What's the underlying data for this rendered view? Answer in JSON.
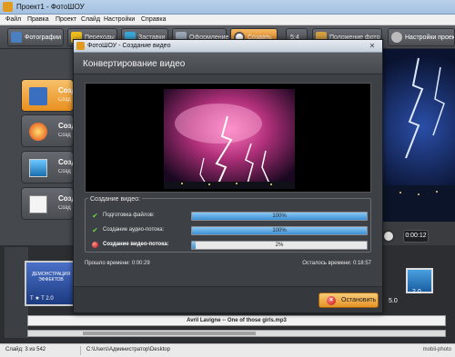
{
  "window": {
    "title": "Проект1 - ФотоШОУ"
  },
  "menu": [
    "Файл",
    "Правка",
    "Проект",
    "Слайд",
    "Настройки",
    "Справка"
  ],
  "toolbar": {
    "tabs": [
      {
        "label": "Фотографии"
      },
      {
        "label": "Переходы"
      },
      {
        "label": "Заставки"
      },
      {
        "label": "Оформление"
      },
      {
        "label": "Создать"
      }
    ],
    "ratio": "5:4",
    "photo_position": "Положение фото",
    "project_settings": "Настройки проек"
  },
  "left_panel": {
    "cards": [
      {
        "label": "Созда",
        "sub": "Созд"
      },
      {
        "label": "Созд",
        "sub": "Созд"
      },
      {
        "label": "Созд",
        "sub": "Созд"
      },
      {
        "label": "Созд",
        "sub": "Созд"
      }
    ]
  },
  "dialog": {
    "window_title": "ФотоШОУ - Создание видео",
    "heading": "Конвертирование видео",
    "group_label": "Создание видео:",
    "steps": [
      {
        "label": "Подготовка файлов:",
        "status": "done",
        "percent_text": "100%",
        "progress": 1.0
      },
      {
        "label": "Создание аудио-потока:",
        "status": "done",
        "percent_text": "100%",
        "progress": 1.0
      },
      {
        "label": "Создание видео-потока:",
        "status": "running",
        "percent_text": "2%",
        "progress": 0.02
      }
    ],
    "elapsed": "Прошло времени: 0:00:29",
    "remaining": "Осталось времени: 0:18:57",
    "stop_label": "Остановить",
    "close_glyph": "✕"
  },
  "player": {
    "time": "0:00:12"
  },
  "timeline": {
    "clip_title": "ДЕМОНСТРАЦИЯ ЭФФЕКТОВ",
    "clip_sub": "T ★ T 2.0",
    "right_label": "2.0",
    "label_50": "5.0",
    "audio_track": "Avril Lavigne -- One of those girls.mp3"
  },
  "status": {
    "slide": "Слайд: 3 из 542",
    "path": "C:\\Users\\Администратор\\Desktop",
    "watermark": "mobil-photo"
  },
  "colors": {
    "accent": "#e8901f",
    "progress": "#3b8fd6",
    "ok": "#6ad14a",
    "running": "#c01010"
  }
}
